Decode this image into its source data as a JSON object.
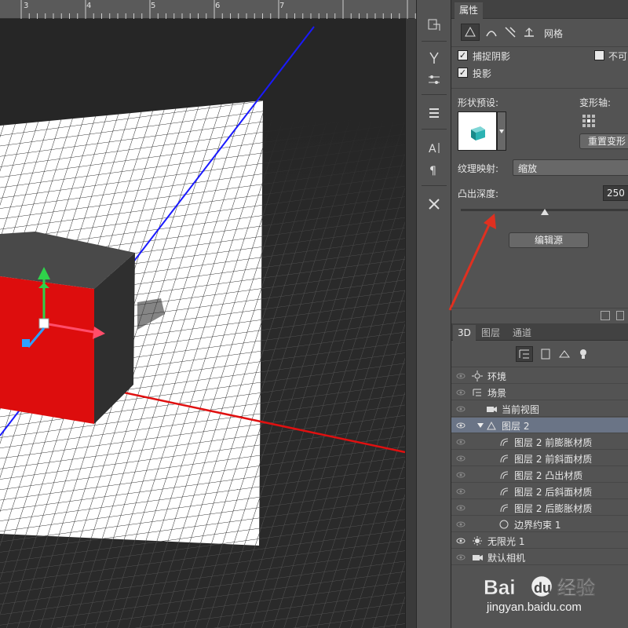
{
  "ruler": {
    "ticks": [
      "3",
      "4",
      "5",
      "6",
      "7"
    ]
  },
  "properties_panel": {
    "tab_label": "属性",
    "mode_tab_mesh": "网格",
    "checkbox_catch_shadow": {
      "label": "捕捉阴影",
      "checked": true
    },
    "checkbox_invisible": {
      "label": "不可",
      "checked": false
    },
    "checkbox_cast_shadow": {
      "label": "投影",
      "checked": true
    },
    "shape_preset_label": "形状预设:",
    "deform_axis_label": "变形轴:",
    "reset_deform_button": "重置变形",
    "texture_map_label": "纹理映射:",
    "texture_map_value": "缩放",
    "extrusion_depth_label": "凸出深度:",
    "extrusion_depth_value": "250",
    "extrusion_depth_fraction": 0.5,
    "edit_source_button": "编辑源"
  },
  "layers_panel": {
    "tabs": [
      "3D",
      "图层",
      "通道"
    ],
    "rows": [
      {
        "label": "环境",
        "icon": "environment-icon",
        "indent": 0,
        "eye": false,
        "selected": false
      },
      {
        "label": "场景",
        "icon": "scene-icon",
        "indent": 0,
        "eye": false,
        "selected": false
      },
      {
        "label": "当前视图",
        "icon": "camera-icon",
        "indent": 1,
        "eye": false,
        "selected": false
      },
      {
        "label": "图层 2",
        "icon": "mesh-icon",
        "indent": 1,
        "eye": true,
        "selected": true
      },
      {
        "label": "图层 2 前膨胀材质",
        "icon": "material-icon",
        "indent": 2,
        "eye": false,
        "selected": false
      },
      {
        "label": "图层 2 前斜面材质",
        "icon": "material-icon",
        "indent": 2,
        "eye": false,
        "selected": false
      },
      {
        "label": "图层 2 凸出材质",
        "icon": "material-icon",
        "indent": 2,
        "eye": false,
        "selected": false
      },
      {
        "label": "图层 2 后斜面材质",
        "icon": "material-icon",
        "indent": 2,
        "eye": false,
        "selected": false
      },
      {
        "label": "图层 2 后膨胀材质",
        "icon": "material-icon",
        "indent": 2,
        "eye": false,
        "selected": false
      },
      {
        "label": "边界约束 1",
        "icon": "constraint-icon",
        "indent": 2,
        "eye": false,
        "selected": false
      },
      {
        "label": "无限光 1",
        "icon": "light-icon",
        "indent": 0,
        "eye": true,
        "selected": false
      },
      {
        "label": "默认相机",
        "icon": "camera-icon",
        "indent": 0,
        "eye": false,
        "selected": false
      }
    ]
  },
  "watermark": {
    "brand": "Bai du 经验",
    "url": "jingyan.baidu.com"
  },
  "colors": {
    "x_axis": "#e01010",
    "y_axis": "#1a1aff",
    "cube_front": "#dd0d0d",
    "cube_top": "#4a4a4a",
    "annotation_arrow": "#e03020",
    "selected_row": "#6a7486"
  }
}
